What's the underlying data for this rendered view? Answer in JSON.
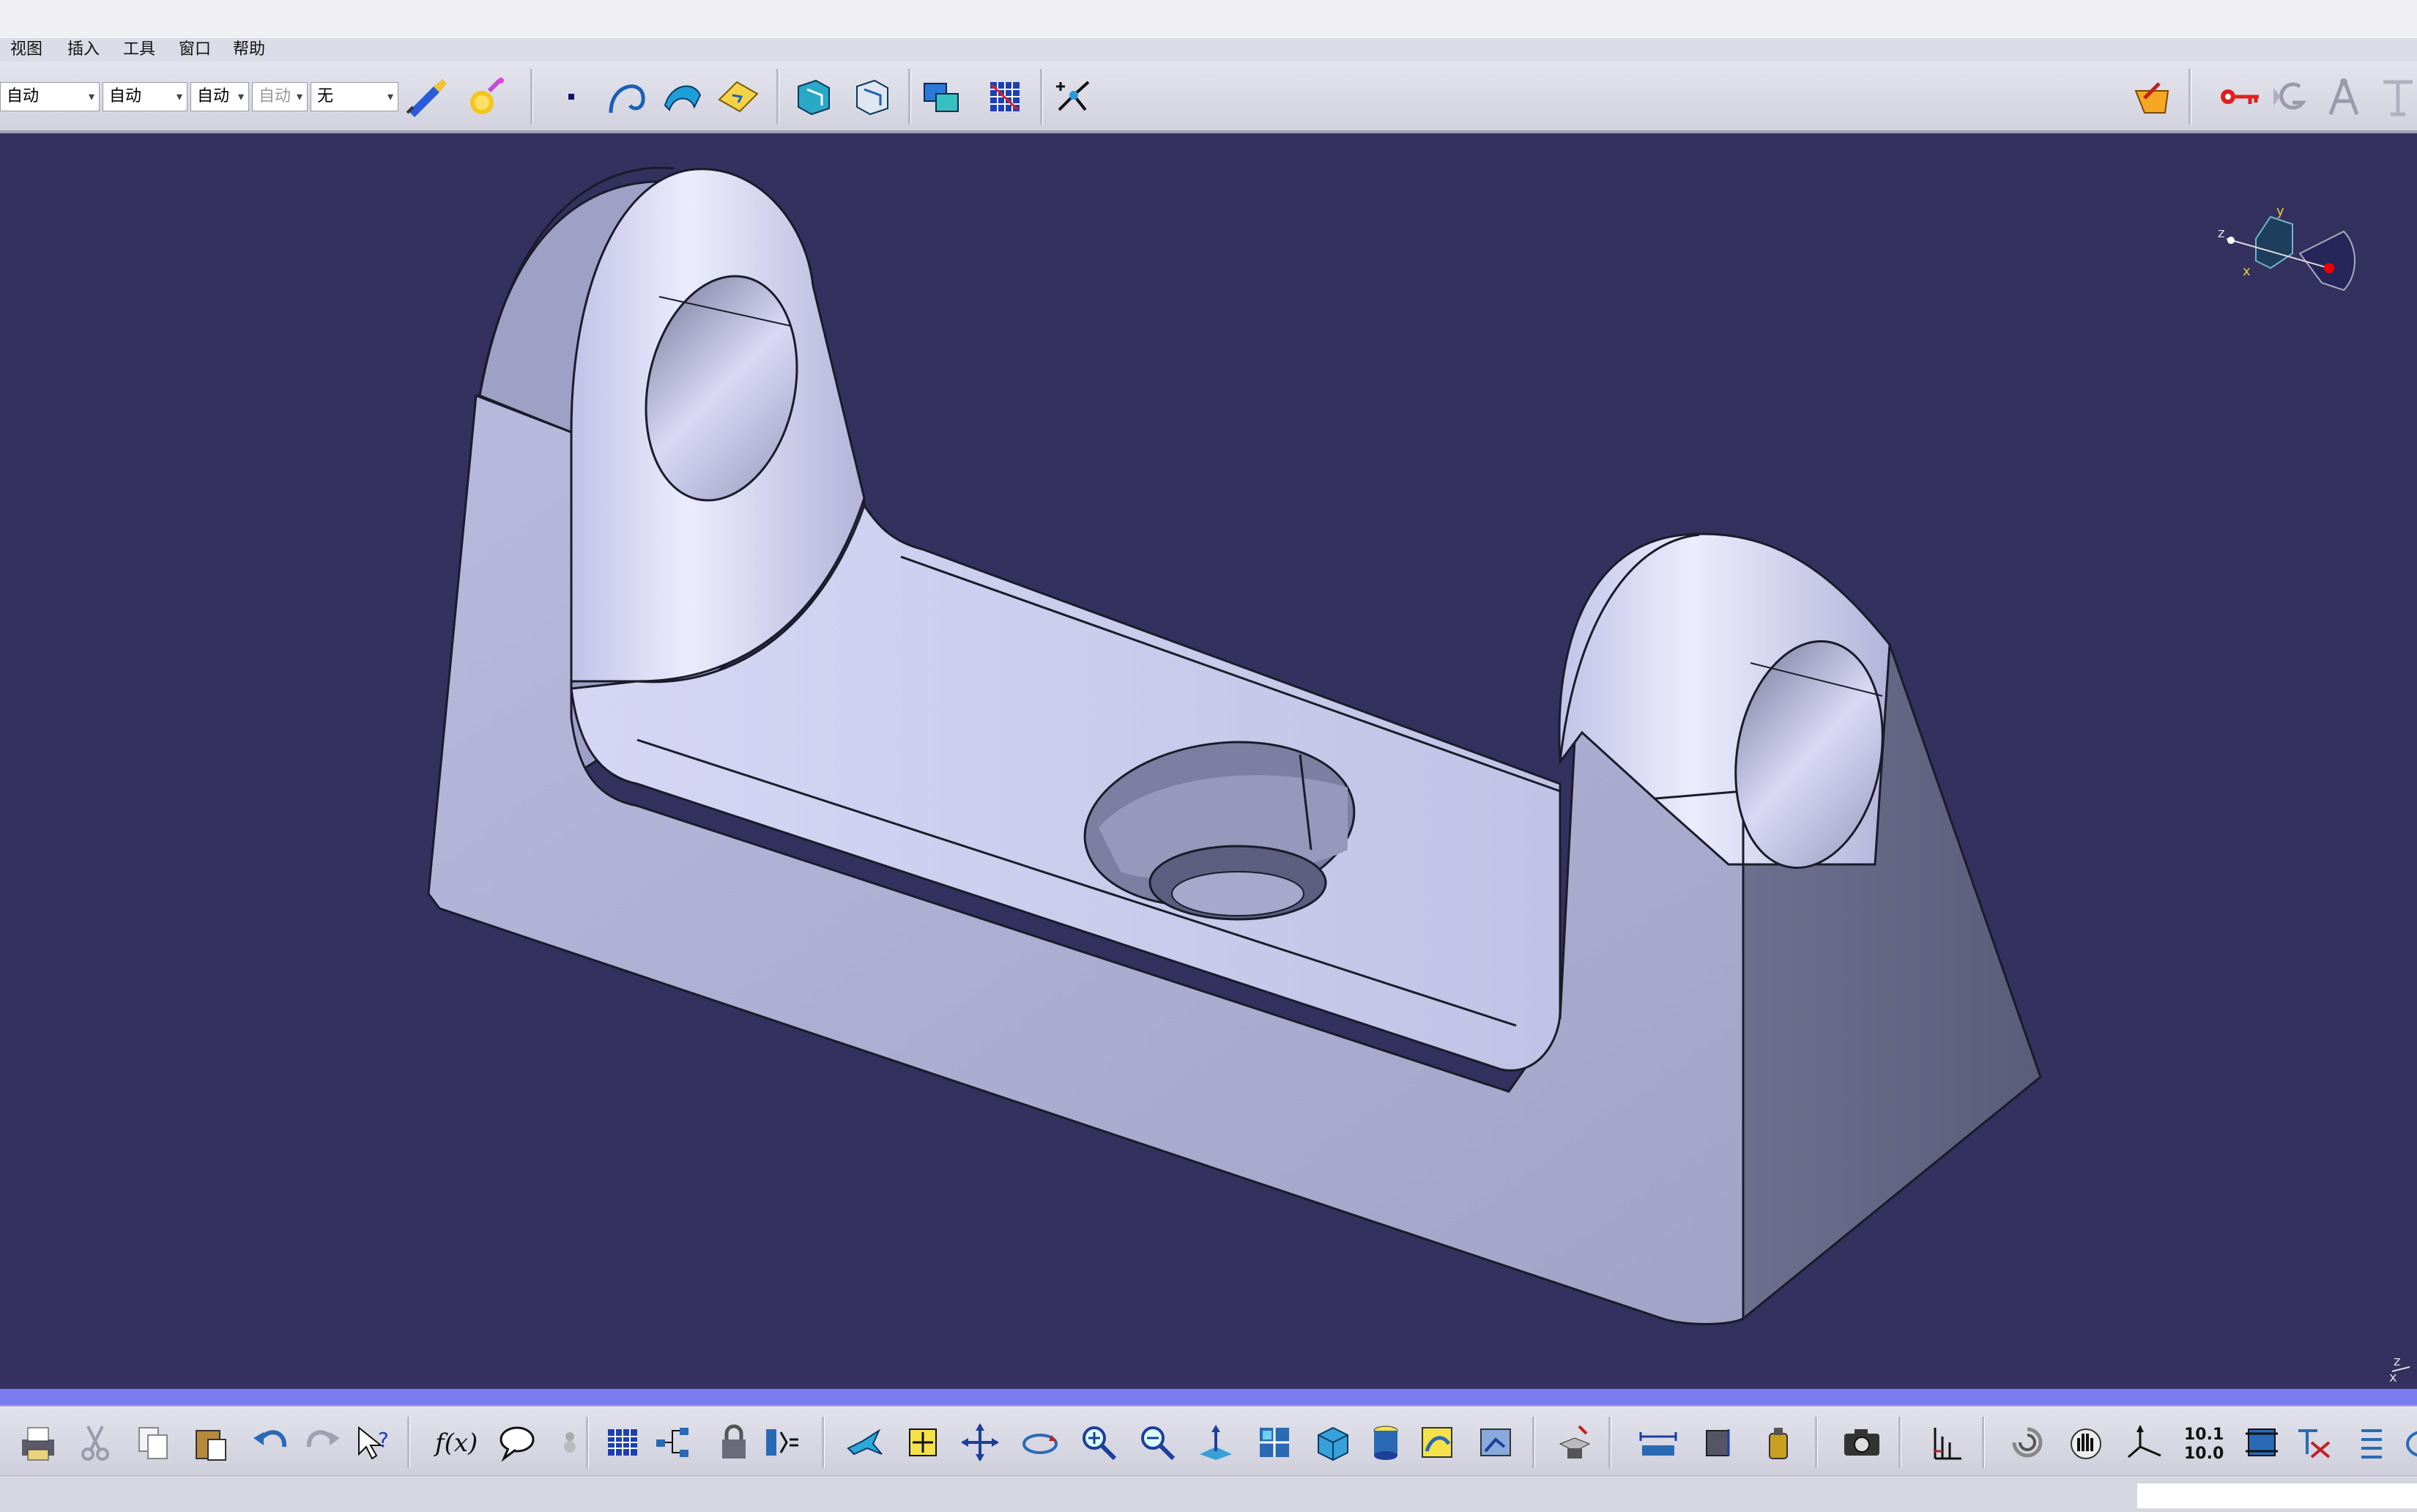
{
  "menu": {
    "items": [
      "视图",
      "插入",
      "工具",
      "窗口",
      "帮助"
    ]
  },
  "graphic_properties": {
    "color": "自动",
    "linetype": "自动",
    "thickness": "自动",
    "weight": "自动",
    "layer": "无"
  },
  "top_toolbar_icons": [
    "painter-brush-icon",
    "apply-material-icon",
    "point-icon",
    "curve-icon",
    "surface-icon",
    "plane-icon",
    "sketch-view-icon",
    "sketch-output-icon",
    "measure-icon",
    "grid-snap-icon",
    "analysis-icon"
  ],
  "top_right_icons": [
    "knowledge-icon",
    "key-icon",
    "generative-icon",
    "compass-tool-icon"
  ],
  "compass": {
    "axes": [
      "z",
      "y",
      "x"
    ]
  },
  "mini_axis": {
    "labels": [
      "z",
      "x"
    ]
  },
  "bottom_toolbar_icons": [
    "print-icon",
    "cut-icon",
    "copy-icon",
    "paste-icon",
    "undo-icon",
    "redo-icon",
    "whats-this-icon",
    "formula-icon",
    "comment-icon",
    "knowledge-advisor-icon",
    "table-icon",
    "tree-icon",
    "lock-icon",
    "equation-icon",
    "fly-mode-icon",
    "fit-all-icon",
    "pan-icon",
    "rotate-icon",
    "zoom-in-icon",
    "zoom-out-icon",
    "normal-view-icon",
    "multi-view-icon",
    "iso-view-icon",
    "shading-icon",
    "hide-show-icon",
    "swap-visible-icon",
    "catalog-icon",
    "measure-between-icon",
    "measure-item-icon",
    "measure-inertia-icon",
    "capture-icon",
    "axis-system-icon",
    "reframe-icon",
    "manipulate-icon",
    "compass-icon",
    "precision-icon",
    "snap-icon",
    "constraint-icon",
    "list-icon"
  ],
  "number_icon_text": [
    "10.1",
    "10.0"
  ],
  "colors": {
    "background": "#34315f",
    "part_face": "#c9c9ee",
    "part_shadow": "#8a8bb0",
    "toolbar": "#d8d8e4",
    "accent_strip": "#7a7cf0"
  }
}
